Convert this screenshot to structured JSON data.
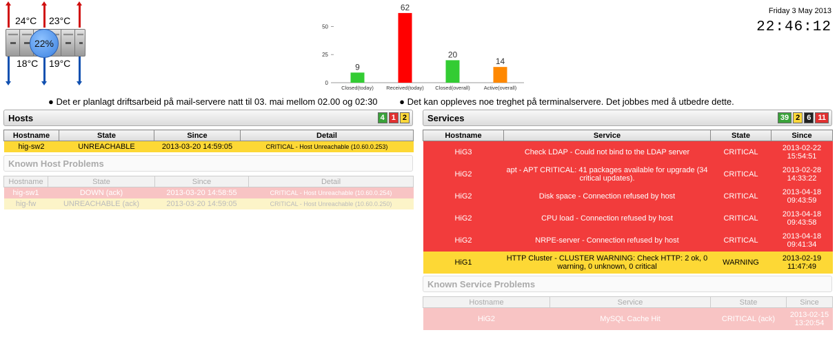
{
  "rack": {
    "temps_out": [
      "24°C",
      "23°C"
    ],
    "temps_in": [
      "18°C",
      "19°C"
    ],
    "load": "22%"
  },
  "chart_data": {
    "type": "bar",
    "categories": [
      "Closed(today)",
      "Received(today)",
      "Closed(overall)",
      "Active(overall)"
    ],
    "values": [
      9,
      62,
      20,
      14
    ],
    "colors": [
      "#33cc33",
      "#ff0000",
      "#33cc33",
      "#ff8800"
    ],
    "yticks": [
      0,
      25,
      50
    ],
    "ylim": [
      0,
      65
    ],
    "grid": false
  },
  "datetime": {
    "date": "Friday 3 May 2013",
    "time": "22:46:12"
  },
  "messages": [
    "Det er planlagt driftsarbeid på mail-servere natt til 03. mai mellom 02.00 og 02:30",
    "Det kan oppleves noe treghet på terminalservere. Det jobbes med å utbedre dette."
  ],
  "hosts": {
    "title": "Hosts",
    "badges": [
      "4",
      "1",
      "2"
    ],
    "columns": [
      "Hostname",
      "State",
      "Since",
      "Detail"
    ],
    "rows": [
      {
        "hostname": "hig-sw2",
        "state": "UNREACHABLE",
        "since": "2013-03-20 14:59:05",
        "detail": "CRITICAL - Host Unreachable (10.60.0.253)"
      }
    ],
    "known_title": "Known Host Problems",
    "known_columns": [
      "Hostname",
      "State",
      "Since",
      "Detail"
    ],
    "known_rows": [
      {
        "hostname": "hig-sw1",
        "state": "DOWN (ack)",
        "since": "2013-03-20 14:58:55",
        "detail": "CRITICAL - Host Unreachable (10.60.0.254)"
      },
      {
        "hostname": "hig-fw",
        "state": "UNREACHABLE (ack)",
        "since": "2013-03-20 14:59:05",
        "detail": "CRITICAL - Host Unreachable (10.60.0.250)"
      }
    ]
  },
  "services": {
    "title": "Services",
    "badges": [
      "39",
      "2",
      "6",
      "11"
    ],
    "columns": [
      "Hostname",
      "Service",
      "State",
      "Since"
    ],
    "rows": [
      {
        "hostname": "HiG3",
        "service": "Check LDAP - Could not bind to the LDAP server",
        "state": "CRITICAL",
        "since_date": "2013-02-22",
        "since_time": "15:54:51"
      },
      {
        "hostname": "HiG2",
        "service": "apt - APT CRITICAL: 41 packages available for upgrade (34 critical updates).",
        "state": "CRITICAL",
        "since_date": "2013-02-28",
        "since_time": "14:33:22"
      },
      {
        "hostname": "HiG2",
        "service": "Disk space - Connection refused by host",
        "state": "CRITICAL",
        "since_date": "2013-04-18",
        "since_time": "09:43:59"
      },
      {
        "hostname": "HiG2",
        "service": "CPU load - Connection refused by host",
        "state": "CRITICAL",
        "since_date": "2013-04-18",
        "since_time": "09:43:58"
      },
      {
        "hostname": "HiG2",
        "service": "NRPE-server - Connection refused by host",
        "state": "CRITICAL",
        "since_date": "2013-04-18",
        "since_time": "09:41:34"
      },
      {
        "hostname": "HiG1",
        "service": "HTTP Cluster - CLUSTER WARNING: Check HTTP: 2 ok, 0 warning, 0 unknown, 0 critical",
        "state": "WARNING",
        "since_date": "2013-02-19",
        "since_time": "11:47:49"
      }
    ],
    "known_title": "Known Service Problems",
    "known_columns": [
      "Hostname",
      "Service",
      "State",
      "Since"
    ],
    "known_rows": [
      {
        "hostname": "HiG2",
        "service": "MySQL Cache Hit",
        "state": "CRITICAL (ack)",
        "since_date": "2013-02-15",
        "since_time": "13:20:54"
      }
    ]
  }
}
